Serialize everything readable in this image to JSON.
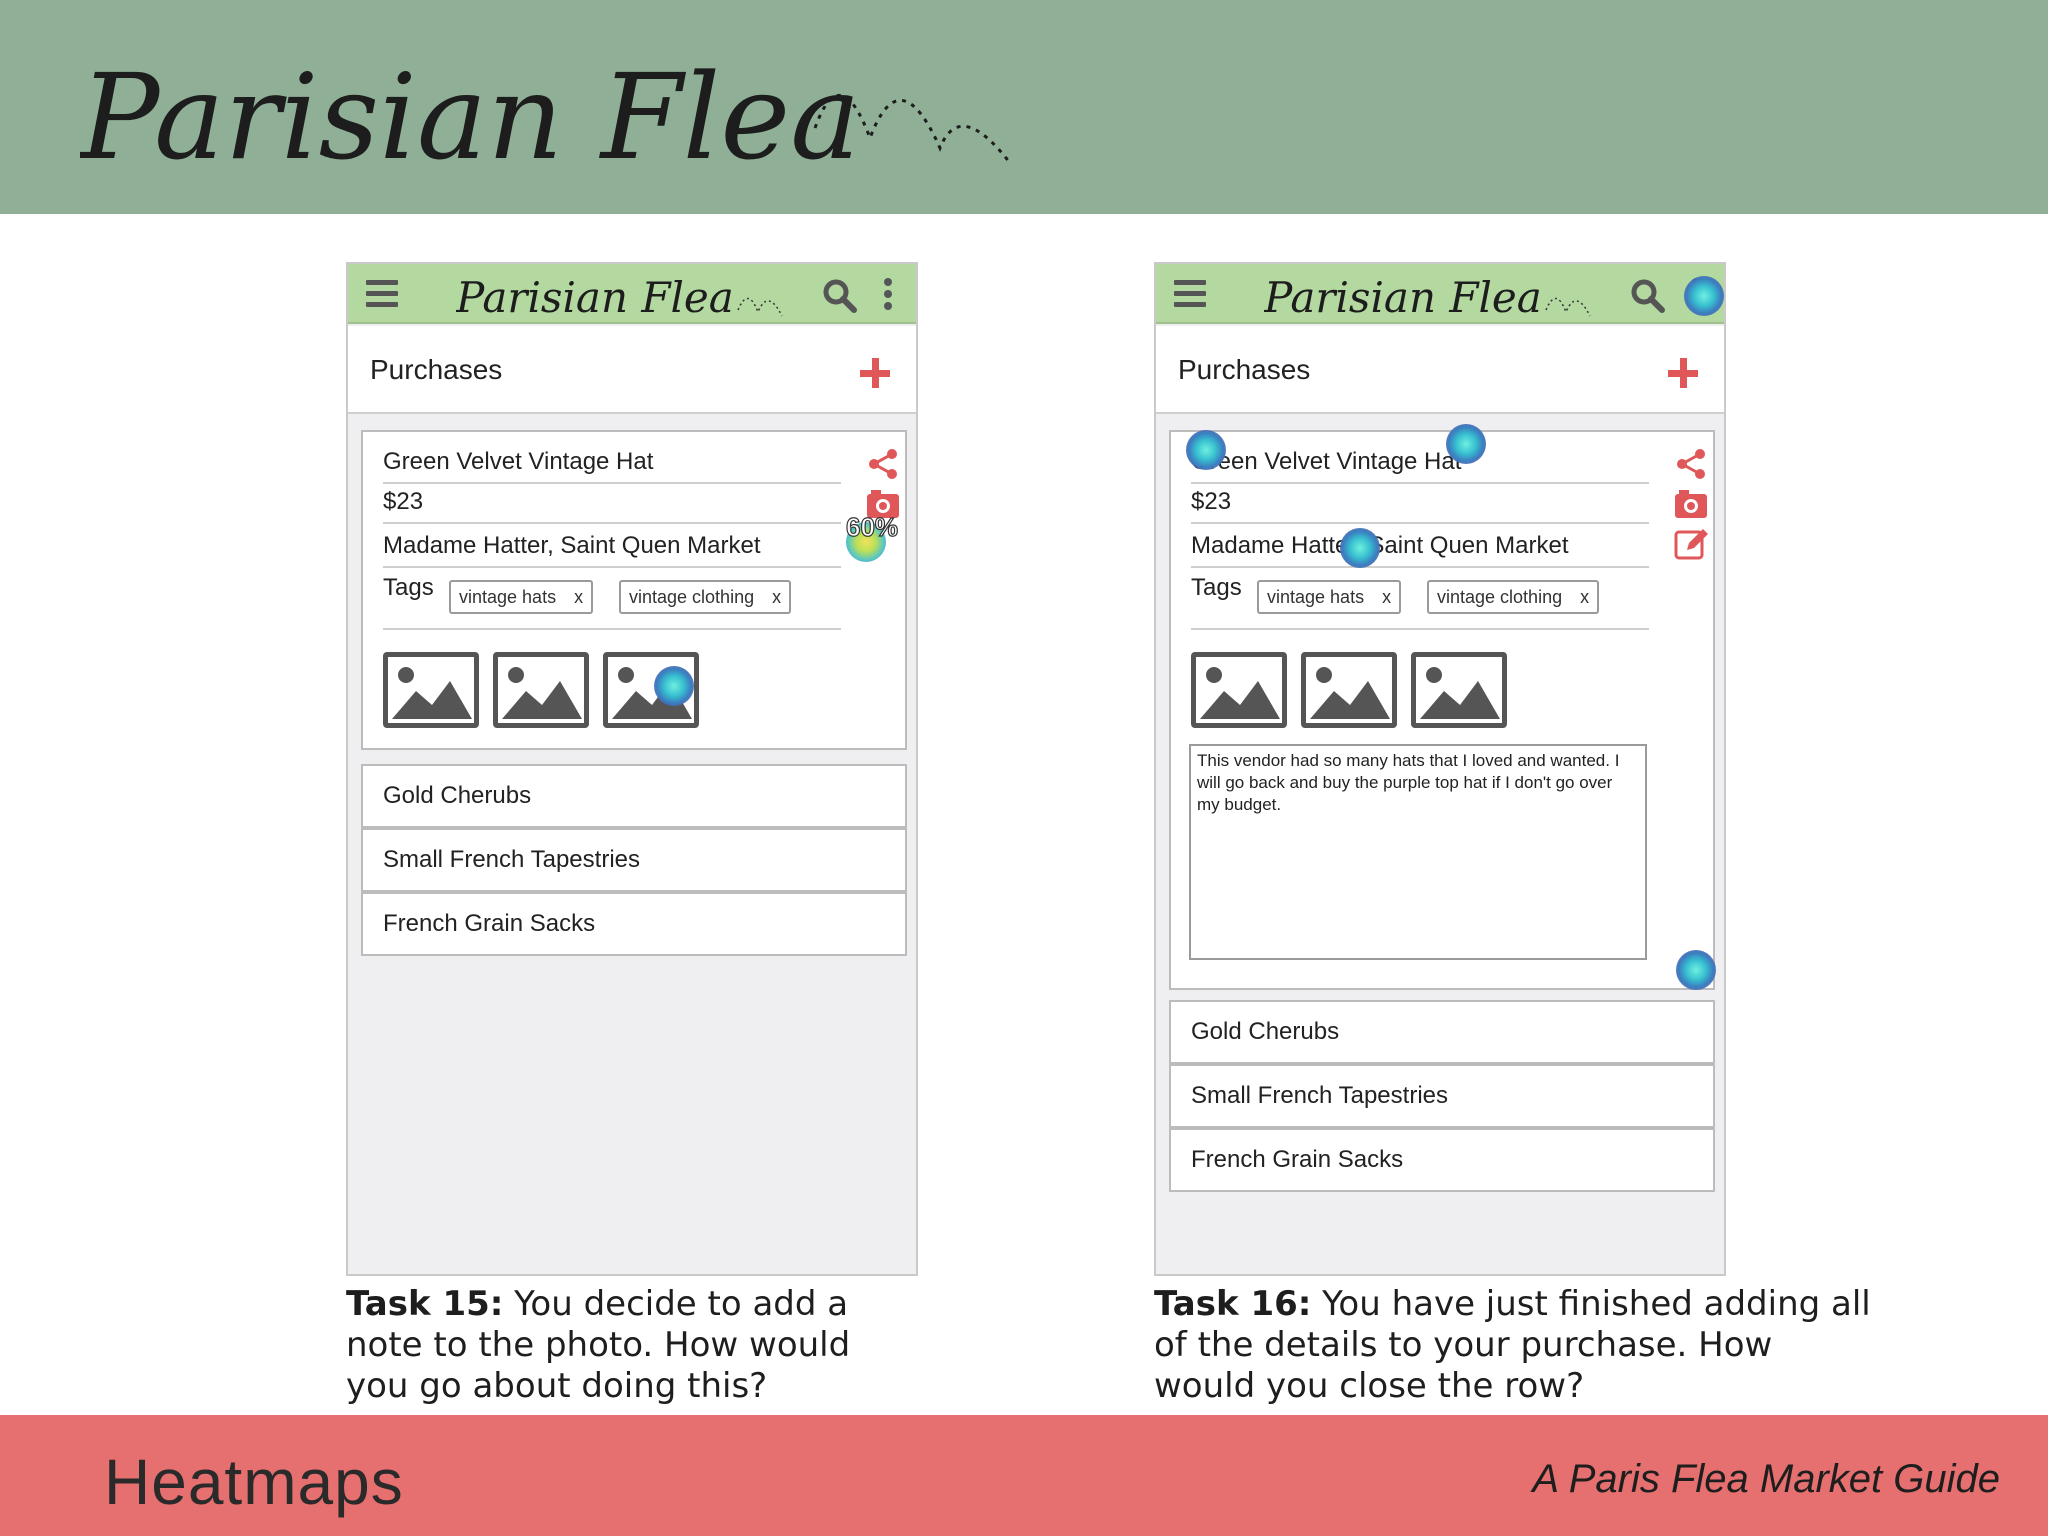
{
  "brand": {
    "logo_text": "Parisian Flea",
    "colors": {
      "banner_green": "#8fb096",
      "app_header_green": "#b3d9a1",
      "footer_red": "#e66f6f",
      "accent_red": "#e0575a"
    }
  },
  "footer": {
    "title": "Heatmaps",
    "subtitle": "A Paris Flea Market Guide"
  },
  "screens": [
    {
      "purchases_title": "Purchases",
      "icons": [
        "menu-icon",
        "search-icon",
        "kebab-icon",
        "add-icon",
        "share-icon",
        "camera-icon"
      ],
      "expanded_item": {
        "name": "Green Velvet Vintage Hat",
        "price": "$23",
        "vendor": "Madame Hatter, Saint Quen Market",
        "tags_label": "Tags",
        "tags": [
          "vintage hats",
          "vintage clothing"
        ],
        "tag_remove": "x",
        "photo_count": 3
      },
      "heatmap_label": "60%",
      "list_items": [
        "Gold Cherubs",
        "Small French Tapestries",
        "French Grain Sacks"
      ],
      "caption": {
        "task": "Task 15:",
        "text": " You decide to add a note to the photo. How would you go about doing this?"
      }
    },
    {
      "purchases_title": "Purchases",
      "icons": [
        "menu-icon",
        "search-icon",
        "kebab-icon",
        "add-icon",
        "share-icon",
        "camera-icon",
        "edit-icon"
      ],
      "expanded_item": {
        "name": "Green Velvet Vintage Hat",
        "price": "$23",
        "vendor": "Madame Hatter, Saint Quen Market",
        "tags_label": "Tags",
        "tags": [
          "vintage hats",
          "vintage clothing"
        ],
        "tag_remove": "x",
        "photo_count": 3,
        "note": "This vendor had so many hats that I loved and wanted. I will go back and buy the purple top hat if I don't go over my budget."
      },
      "list_items": [
        "Gold Cherubs",
        "Small French Tapestries",
        "French Grain Sacks"
      ],
      "caption": {
        "task": "Task 16:",
        "text": " You have just finished adding all of the details to your purchase. How would you close the row?"
      }
    }
  ]
}
